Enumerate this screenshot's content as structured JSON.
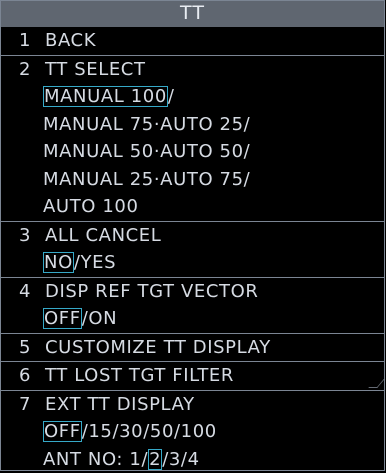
{
  "title": "TT",
  "items": {
    "back": {
      "num": "1",
      "label": "BACK"
    },
    "tt_select": {
      "num": "2",
      "label": "TT SELECT",
      "options": [
        "MANUAL 100",
        "/",
        "MANUAL 75·AUTO 25/",
        "MANUAL 50·AUTO 50/",
        "MANUAL 25·AUTO 75/",
        "AUTO 100"
      ]
    },
    "all_cancel": {
      "num": "3",
      "label": "ALL CANCEL",
      "opt_selected": "NO",
      "opt_rest": "/YES"
    },
    "disp_ref": {
      "num": "4",
      "label": "DISP REF TGT VECTOR",
      "opt_selected": "OFF",
      "opt_rest": "/ON"
    },
    "customize": {
      "num": "5",
      "label": "CUSTOMIZE TT DISPLAY"
    },
    "lost_filter": {
      "num": "6",
      "label": "TT LOST TGT FILTER"
    },
    "ext_display": {
      "num": "7",
      "label": "EXT TT DISPLAY",
      "opt_selected": "OFF",
      "opt_rest": "/15/30/50/100",
      "ant_label": "ANT NO: ",
      "ant_before": "1/",
      "ant_selected": "2",
      "ant_after": "/3/4"
    }
  },
  "colors": {
    "background": "#000000",
    "title_bar": "#5f6670",
    "text": "#d6dbe3",
    "selection_box": "#36a9c8",
    "separator": "#7b8593"
  }
}
